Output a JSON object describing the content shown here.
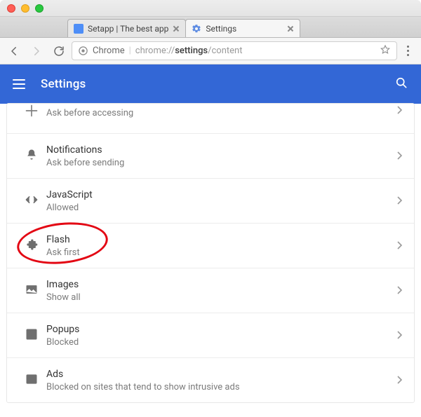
{
  "tabs": [
    {
      "title": "Setapp | The best app",
      "favicon": "setapp"
    },
    {
      "title": "Settings",
      "favicon": "gear"
    }
  ],
  "active_tab_index": 1,
  "omnibox": {
    "scheme_label": "Chrome",
    "url_gray_prefix": "chrome://",
    "url_bold": "settings",
    "url_gray_suffix": "/content"
  },
  "header": {
    "title": "Settings"
  },
  "rows": [
    {
      "icon": "location",
      "title": "",
      "subtitle": "Ask before accessing"
    },
    {
      "icon": "bell",
      "title": "Notifications",
      "subtitle": "Ask before sending"
    },
    {
      "icon": "code",
      "title": "JavaScript",
      "subtitle": "Allowed"
    },
    {
      "icon": "puzzle",
      "title": "Flash",
      "subtitle": "Ask first"
    },
    {
      "icon": "image",
      "title": "Images",
      "subtitle": "Show all"
    },
    {
      "icon": "popup",
      "title": "Popups",
      "subtitle": "Blocked"
    },
    {
      "icon": "ad",
      "title": "Ads",
      "subtitle": "Blocked on sites that tend to show intrusive ads"
    }
  ]
}
